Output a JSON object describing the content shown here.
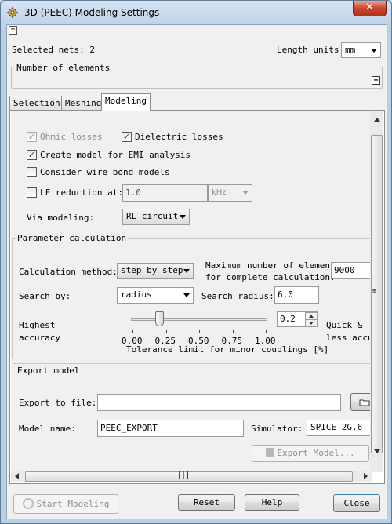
{
  "window": {
    "title": "3D (PEEC) Modeling Settings",
    "close_glyph": "✕"
  },
  "header": {
    "selected_nets": "Selected nets: 2",
    "length_units_label": "Length units:",
    "length_units_value": "mm",
    "elements_group_title": "Number of elements",
    "expand_glyph": "+",
    "collapse_glyph": "−"
  },
  "tabs": [
    {
      "label": "Selection",
      "active": false
    },
    {
      "label": "Meshing",
      "active": false
    },
    {
      "label": "Modeling",
      "active": true
    }
  ],
  "modeling": {
    "ohmic_losses": {
      "label": "Ohmic losses",
      "checked": true,
      "enabled": false
    },
    "dielectric_losses": {
      "label": "Dielectric losses",
      "checked": true
    },
    "emi_model": {
      "label": "Create model for EMI analysis",
      "checked": true
    },
    "wire_bond": {
      "label": "Consider wire bond models",
      "checked": false
    },
    "lf_reduction": {
      "label": "LF reduction at:",
      "checked": false,
      "value": "1.0",
      "unit": "kHz"
    },
    "via_modeling": {
      "label": "Via modeling:",
      "value": "RL circuit"
    },
    "check_glyph": "✓"
  },
  "parameter_calculation": {
    "title": "Parameter calculation",
    "calc_method_label": "Calculation method:",
    "calc_method_value": "step by step",
    "max_elements_label_1": "Maximum number of elements",
    "max_elements_label_2": "for complete calculation:",
    "max_elements_value": "9000",
    "search_by_label": "Search by:",
    "search_by_value": "radius",
    "search_radius_label": "Search radius:",
    "search_radius_value": "6.0",
    "highest_accuracy_1": "Highest",
    "highest_accuracy_2": "accuracy",
    "quick_1": "Quick &",
    "quick_2": "less accu",
    "slider_value": 0.2,
    "slider_ticks": [
      "0.00",
      "0.25",
      "0.50",
      "0.75",
      "1.00"
    ],
    "spinner_value": "0.2",
    "tolerance_caption": "Tolerance limit for minor couplings [%]"
  },
  "export_model": {
    "title": "Export model",
    "export_to_file_label": "Export to file:",
    "export_to_file_value": "",
    "model_name_label": "Model name:",
    "model_name_value": "PEEC_EXPORT",
    "simulator_label": "Simulator:",
    "simulator_value": "SPICE 2G.6",
    "export_button": "Export Model..."
  },
  "footer": {
    "start_modeling": "Start Modeling",
    "reset": "Reset",
    "help": "Help",
    "close": "Close"
  },
  "scrollbar": {
    "grip_glyph": "|||"
  }
}
